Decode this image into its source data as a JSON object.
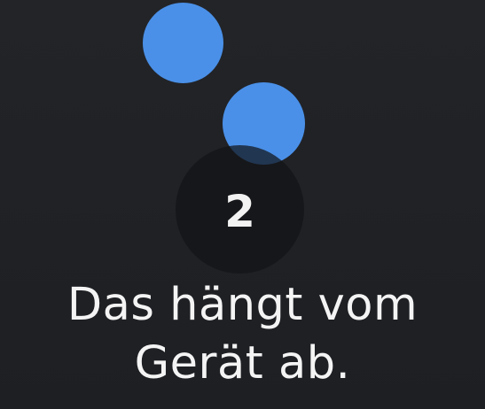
{
  "step": {
    "number": "2"
  },
  "message": {
    "line1": "Das hängt vom",
    "line2": "Gerät ab."
  },
  "colors": {
    "dot": "#4a90e8",
    "background": "#222327",
    "text": "#f4f4f4"
  }
}
